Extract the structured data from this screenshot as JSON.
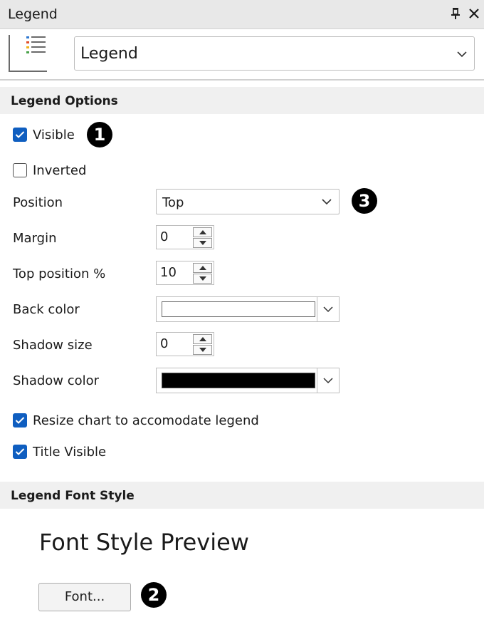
{
  "window": {
    "title": "Legend"
  },
  "header": {
    "selector_value": "Legend",
    "icon": "legend-list-icon"
  },
  "sections": {
    "options_title": "Legend Options",
    "font_title": "Legend Font Style"
  },
  "options": {
    "visible": {
      "label": "Visible",
      "checked": true
    },
    "inverted": {
      "label": "Inverted",
      "checked": false
    },
    "position": {
      "label": "Position",
      "value": "Top"
    },
    "margin": {
      "label": "Margin",
      "value": "0"
    },
    "top_position": {
      "label": "Top position %",
      "value": "10"
    },
    "back_color": {
      "label": "Back color",
      "color": "#ffffff"
    },
    "shadow_size": {
      "label": "Shadow size",
      "value": "0"
    },
    "shadow_color": {
      "label": "Shadow color",
      "color": "#000000"
    },
    "resize_chart": {
      "label": "Resize chart to accomodate legend",
      "checked": true
    },
    "title_visible": {
      "label": "Title Visible",
      "checked": true
    }
  },
  "font_style": {
    "preview_text": "Font Style Preview",
    "font_button": "Font..."
  },
  "callouts": {
    "one": "1",
    "two": "2",
    "three": "3"
  },
  "colors": {
    "accent": "#0f5ec0",
    "section_bg": "#f0f0f0",
    "titlebar_bg": "#e8e8e8"
  }
}
